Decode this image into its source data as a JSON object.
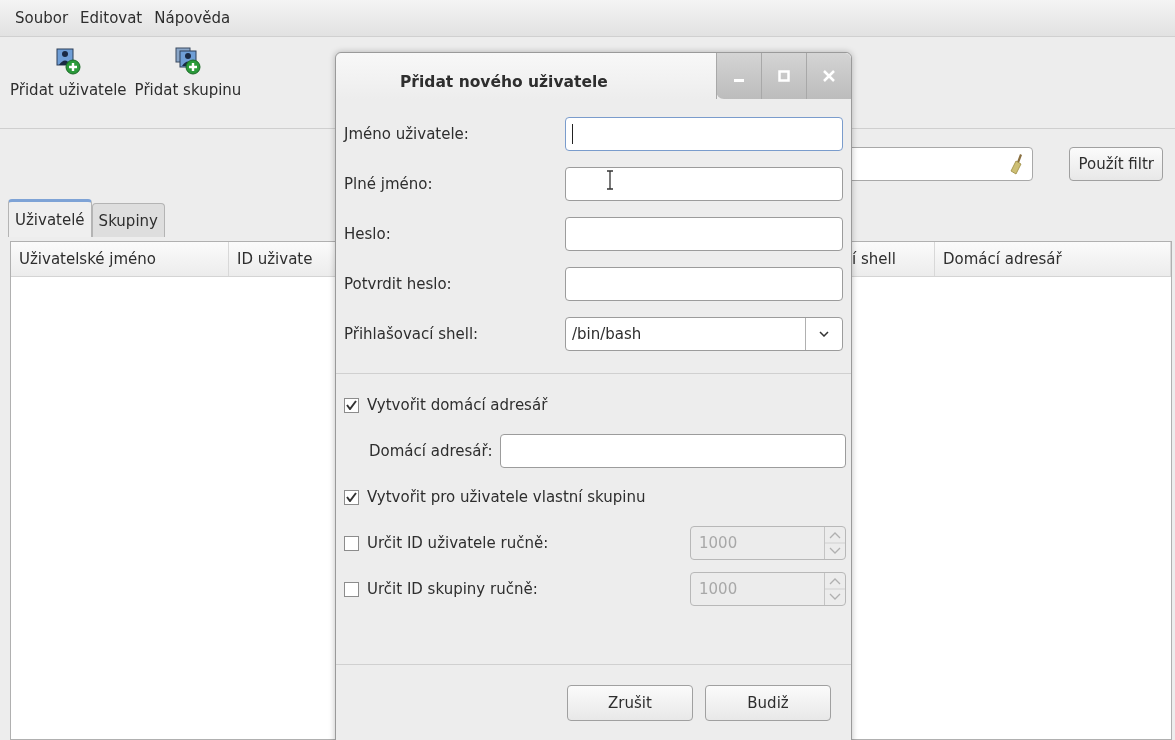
{
  "menu": [
    "Soubor",
    "Editovat",
    "Nápověda"
  ],
  "toolbar": [
    {
      "kind": "user",
      "label": "Přidat uživatele"
    },
    {
      "kind": "group",
      "label": "Přidat skupinu"
    }
  ],
  "filter": {
    "button": "Použít filtr"
  },
  "tabs": [
    {
      "label": "Uživatelé",
      "selected": true
    },
    {
      "label": "Skupiny",
      "selected": false
    }
  ],
  "table": {
    "columns": [
      "Uživatelské jméno",
      "ID uživate",
      "í shell",
      "Domácí adresář"
    ]
  },
  "dialog": {
    "title": "Přidat nového uživatele",
    "fields": [
      {
        "kind": "text",
        "label": "Jméno uživatele:",
        "focused": true
      },
      {
        "kind": "text",
        "label": "Plné jméno:",
        "focused": false
      },
      {
        "kind": "text",
        "label": "Heslo:",
        "focused": false
      },
      {
        "kind": "text",
        "label": "Potvrdit heslo:",
        "focused": false
      },
      {
        "kind": "select",
        "label": "Přihlašovací shell:",
        "value": "/bin/bash"
      }
    ],
    "options": [
      {
        "kind": "checkbox",
        "label": "Vytvořit domácí adresář",
        "checked": true
      },
      {
        "kind": "field",
        "label": "Domácí adresář:"
      },
      {
        "kind": "checkbox",
        "label": "Vytvořit pro uživatele vlastní skupinu",
        "checked": true
      },
      {
        "kind": "spin",
        "label": "Určit ID uživatele ručně:",
        "checked": false,
        "value": "1000",
        "disabled": true
      },
      {
        "kind": "spin",
        "label": "Určit ID skupiny ručně:",
        "checked": false,
        "value": "1000",
        "disabled": true
      }
    ],
    "buttons": [
      "Zrušit",
      "Budiž"
    ]
  }
}
